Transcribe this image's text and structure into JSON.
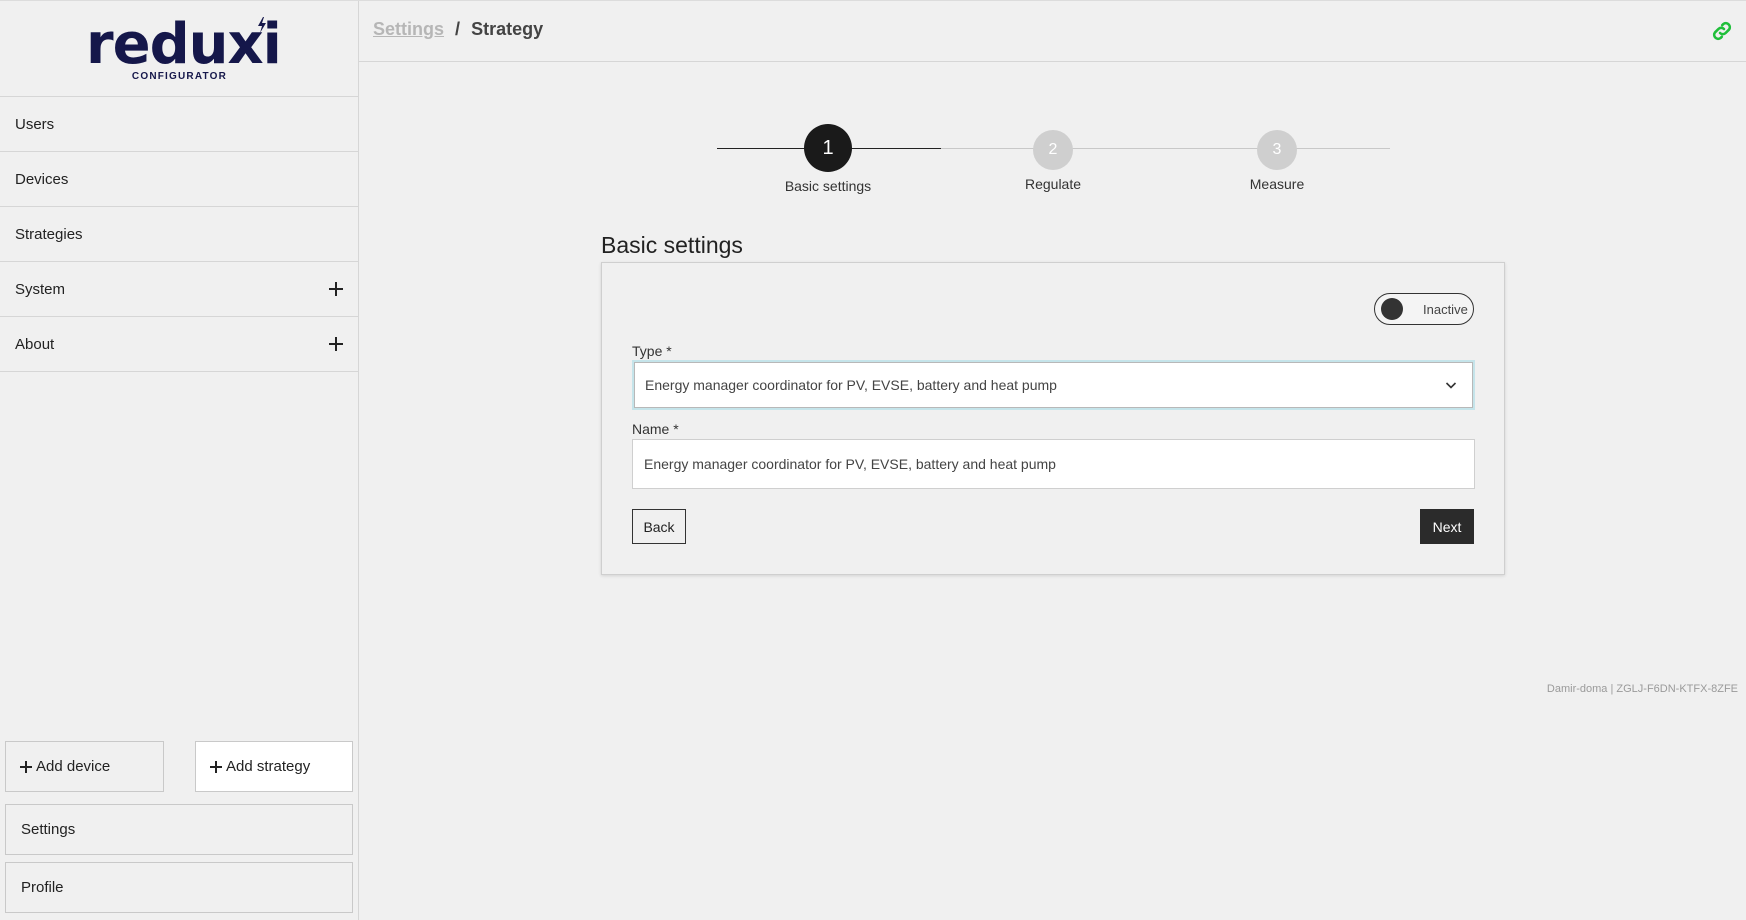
{
  "logo": {
    "name": "reduxi",
    "subtitle": "CONFIGURATOR"
  },
  "sidebar": {
    "items": [
      {
        "label": "Users",
        "expandable": false
      },
      {
        "label": "Devices",
        "expandable": false
      },
      {
        "label": "Strategies",
        "expandable": false
      },
      {
        "label": "System",
        "expandable": true
      },
      {
        "label": "About",
        "expandable": true
      }
    ],
    "add_device_label": "Add device",
    "add_strategy_label": "Add strategy",
    "settings_label": "Settings",
    "profile_label": "Profile"
  },
  "header": {
    "breadcrumb": {
      "parent": "Settings",
      "separator": "/",
      "current": "Strategy"
    },
    "link_icon": "link-icon",
    "link_icon_color": "#1fbf3a"
  },
  "stepper": {
    "active_index": 0,
    "steps": [
      {
        "number": "1",
        "label": "Basic settings"
      },
      {
        "number": "2",
        "label": "Regulate"
      },
      {
        "number": "3",
        "label": "Measure"
      }
    ]
  },
  "form": {
    "title": "Basic settings",
    "status_toggle": {
      "label": "Inactive",
      "active": false
    },
    "type": {
      "label": "Type *",
      "value": "Energy manager coordinator for PV, EVSE, battery and heat pump"
    },
    "name": {
      "label": "Name *",
      "value": "Energy manager coordinator for PV, EVSE, battery and heat pump"
    },
    "back_label": "Back",
    "next_label": "Next"
  },
  "footer": {
    "device_id": "Damir-doma | ZGLJ-F6DN-KTFX-8ZFE"
  },
  "colors": {
    "active_step": "#1a1a1a",
    "inactive_step": "#cfcfcf",
    "primary_button": "#2b2b2b"
  }
}
